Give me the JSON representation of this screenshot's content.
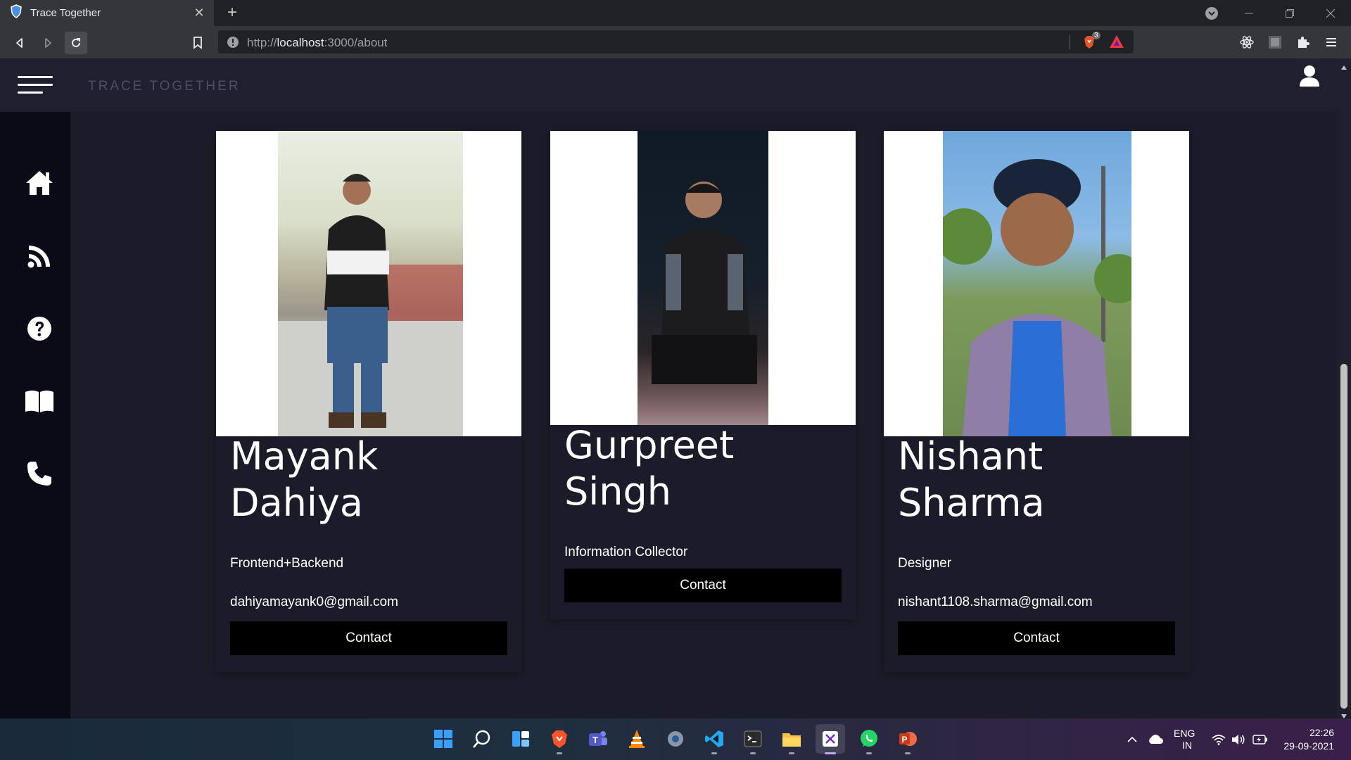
{
  "browser": {
    "tab_title": "Trace Together",
    "url_scheme": "http://",
    "url_host": "localhost",
    "url_path": ":3000/about",
    "brave_badge": "3"
  },
  "app": {
    "brand": "TRACE TOGETHER",
    "sidebar": [
      "home-icon",
      "rss-feed-icon",
      "help-icon",
      "book-icon",
      "phone-icon"
    ]
  },
  "team": [
    {
      "name": "Mayank Dahiya",
      "role": "Frontend+Backend",
      "email": "dahiyamayank0@gmail.com",
      "button": "Contact"
    },
    {
      "name": "Gurpreet Singh",
      "role": "Information Collector",
      "button": "Contact"
    },
    {
      "name": "Nishant Sharma",
      "role": "Designer",
      "email": "nishant1108.sharma@gmail.com",
      "button": "Contact"
    }
  ],
  "taskbar": {
    "lang": "ENG",
    "region": "IN",
    "time": "22:26",
    "date": "29-09-2021"
  },
  "colors": {
    "page_bg": "#1b1b29",
    "header_bg": "#1f1f2f",
    "sidebar_bg": "#0b0b17",
    "button_bg": "#000000",
    "brand_text": "#4c4f61"
  }
}
